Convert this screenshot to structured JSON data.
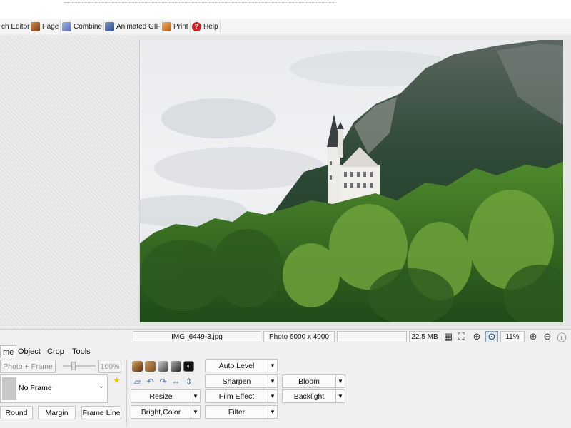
{
  "menu": {
    "items": [
      {
        "label": "ch Editor",
        "icon": "batch-editor-icon",
        "color": "#b7b7b7"
      },
      {
        "label": "Page",
        "icon": "page-icon",
        "color": "#a55c2b"
      },
      {
        "label": "Combine",
        "icon": "combine-icon",
        "color": "#5a6fb5"
      },
      {
        "label": "Animated GIF",
        "icon": "animated-gif-icon",
        "color": "#4a6ea8"
      },
      {
        "label": "Print",
        "icon": "print-icon",
        "color": "#c97a2a"
      },
      {
        "label": "Help",
        "icon": "help-icon",
        "color": "#cc1f1f"
      }
    ]
  },
  "status": {
    "filename": "IMG_6449-3.jpg",
    "photo_info": "Photo 6000 x 4000",
    "empty": "",
    "file_size": "22.5 MB",
    "zoom": "11%"
  },
  "panel": {
    "tabs": [
      "me",
      "Object",
      "Crop",
      "Tools"
    ],
    "frame_mode": "Photo + Frame",
    "opacity": "100%",
    "frame_select": "No Frame",
    "buttons_left": [
      "Round",
      "Margin",
      "Frame Line"
    ],
    "edit_buttons": {
      "resize": "Resize",
      "bright_color": "Bright,Color",
      "auto_level": "Auto Level",
      "sharpen": "Sharpen",
      "film_effect": "Film Effect",
      "filter": "Filter",
      "bloom": "Bloom",
      "backlight": "Backlight"
    }
  },
  "colors": {
    "accent_blue": "#3c6fb4",
    "star": "#f2c200"
  }
}
